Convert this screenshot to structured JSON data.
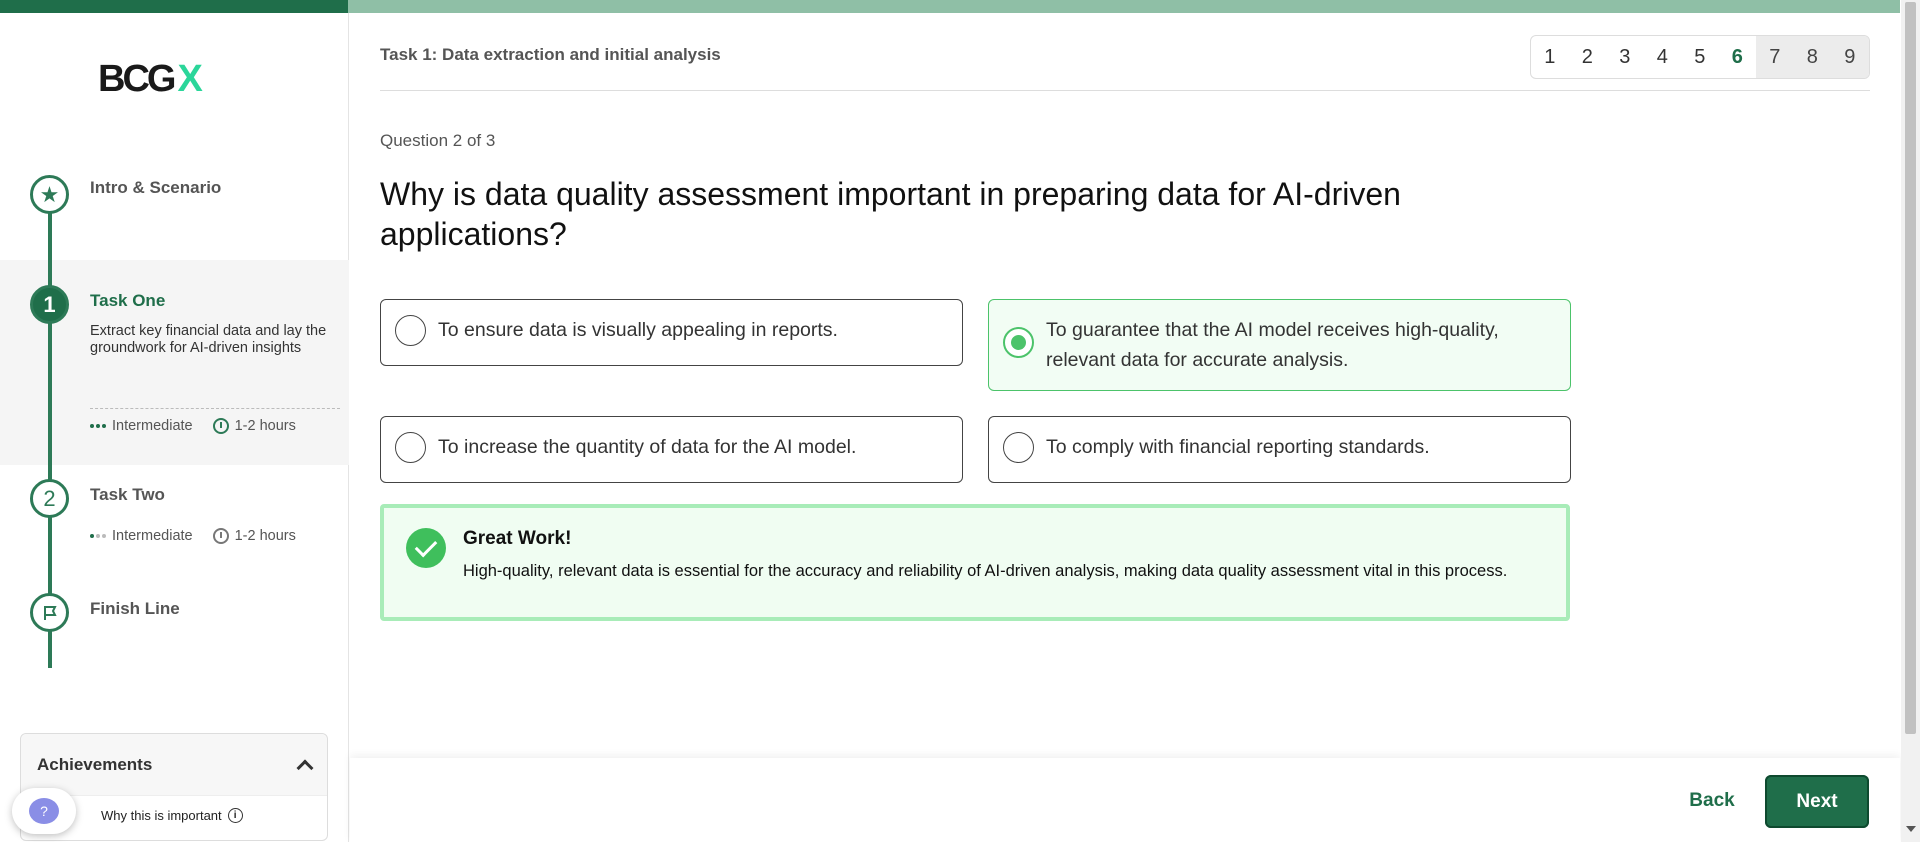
{
  "progress": {
    "fraction": 0.183
  },
  "sidebar": {
    "logo": {
      "text": "BCG",
      "mark": "X"
    },
    "steps": [
      {
        "number": "",
        "icon": "star-icon",
        "title": "Intro & Scenario"
      },
      {
        "number": "1",
        "title": "Task One",
        "description": "Extract key financial data and lay the groundwork for AI-driven insights",
        "level": "Intermediate",
        "duration": "1-2 hours"
      },
      {
        "number": "2",
        "title": "Task Two",
        "level": "Intermediate",
        "duration": "1-2 hours"
      },
      {
        "number": "",
        "icon": "flag-icon",
        "title": "Finish Line"
      }
    ],
    "achievements": {
      "title": "Achievements",
      "why_label": "Why this is important",
      "help_glyph": "?"
    }
  },
  "header": {
    "task_title": "Task 1: Data extraction and initial analysis",
    "pages": [
      "1",
      "2",
      "3",
      "4",
      "5",
      "6",
      "7",
      "8",
      "9"
    ],
    "current_page": "6"
  },
  "question": {
    "counter": "Question 2 of 3",
    "text": "Why is data quality assessment important in preparing data for AI-driven applications?",
    "options": [
      {
        "label": "To ensure data is visually appealing in reports.",
        "selected": false
      },
      {
        "label": "To guarantee that the AI model receives high-quality, relevant data for accurate analysis.",
        "selected": true
      },
      {
        "label": "To increase the quantity of data for the AI model.",
        "selected": false
      },
      {
        "label": "To comply with financial reporting standards.",
        "selected": false
      }
    ]
  },
  "feedback": {
    "title": "Great Work!",
    "text": "High-quality, relevant data is essential for the accuracy and reliability of AI-driven analysis, making data quality assessment vital in this process."
  },
  "footer": {
    "back_label": "Back",
    "next_label": "Next"
  },
  "colors": {
    "brand": "#1f6e4a",
    "success": "#4cc36a",
    "logo_accent": "#2bd69a"
  }
}
